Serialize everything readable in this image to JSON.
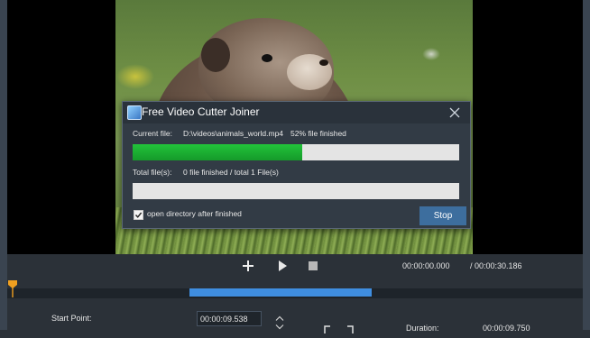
{
  "dialog": {
    "title": "Free Video Cutter Joiner",
    "current_file_label": "Current file:",
    "current_file_path": "D:\\videos\\animals_world.mp4",
    "current_file_status": "52% file finished",
    "current_progress": 0.52,
    "total_files_label": "Total file(s):",
    "total_files_status": "0 file finished / total 1 File(s)",
    "total_progress": 0.0,
    "open_directory_label": "open directory after finished",
    "open_directory_checked": true,
    "stop_label": "Stop",
    "icons": {
      "app": "app-icon",
      "close": "close-icon"
    }
  },
  "controls": {
    "icons": [
      "add-icon",
      "play-icon",
      "stop-icon"
    ],
    "current_time": "00:00:00.000",
    "total_time": "/ 00:00:30.186"
  },
  "timeline": {
    "selection_start": 0.316,
    "selection_end": 0.634
  },
  "bottom": {
    "start_point_label": "Start Point:",
    "start_point_value": "00:00:09.538",
    "duration_label": "Duration:",
    "duration_value": "00:00:09.750"
  },
  "colors": {
    "accent": "#3f8ee0",
    "progress_green": "#1fb534",
    "stop_button": "#3d6e9e",
    "playhead": "#f0a020"
  }
}
